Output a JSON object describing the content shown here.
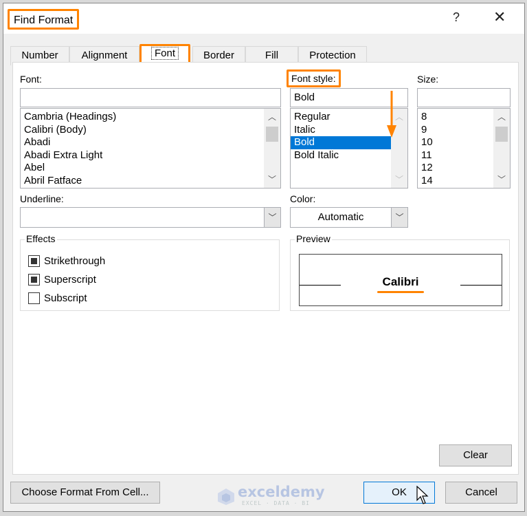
{
  "dialog": {
    "title": "Find Format",
    "help_label": "?",
    "close_label": "✕"
  },
  "tabs": [
    {
      "label": "Number",
      "active": false
    },
    {
      "label": "Alignment",
      "active": false
    },
    {
      "label": "Font",
      "active": true
    },
    {
      "label": "Border",
      "active": false
    },
    {
      "label": "Fill",
      "active": false
    },
    {
      "label": "Protection",
      "active": false
    }
  ],
  "font": {
    "label": "Font:",
    "value": "",
    "options": [
      "Cambria (Headings)",
      "Calibri (Body)",
      "Abadi",
      "Abadi Extra Light",
      "Abel",
      "Abril Fatface"
    ]
  },
  "font_style": {
    "label": "Font style:",
    "value": "Bold",
    "options": [
      "Regular",
      "Italic",
      "Bold",
      "Bold Italic"
    ],
    "selected": "Bold"
  },
  "size": {
    "label": "Size:",
    "value": "",
    "options": [
      "8",
      "9",
      "10",
      "11",
      "12",
      "14"
    ]
  },
  "underline": {
    "label": "Underline:",
    "value": ""
  },
  "color": {
    "label": "Color:",
    "value": "Automatic"
  },
  "effects": {
    "title": "Effects",
    "items": [
      {
        "label": "Strikethrough",
        "state": "indeterminate"
      },
      {
        "label": "Superscript",
        "state": "indeterminate"
      },
      {
        "label": "Subscript",
        "state": "unchecked"
      }
    ]
  },
  "preview": {
    "title": "Preview",
    "text": "Calibri"
  },
  "buttons": {
    "clear": "Clear",
    "choose_format": "Choose Format From Cell...",
    "ok": "OK",
    "cancel": "Cancel"
  },
  "watermark": {
    "brand": "exceldemy",
    "tagline": "EXCEL · DATA · BI"
  },
  "colors": {
    "highlight": "#ff8300",
    "selection": "#0078d7"
  }
}
